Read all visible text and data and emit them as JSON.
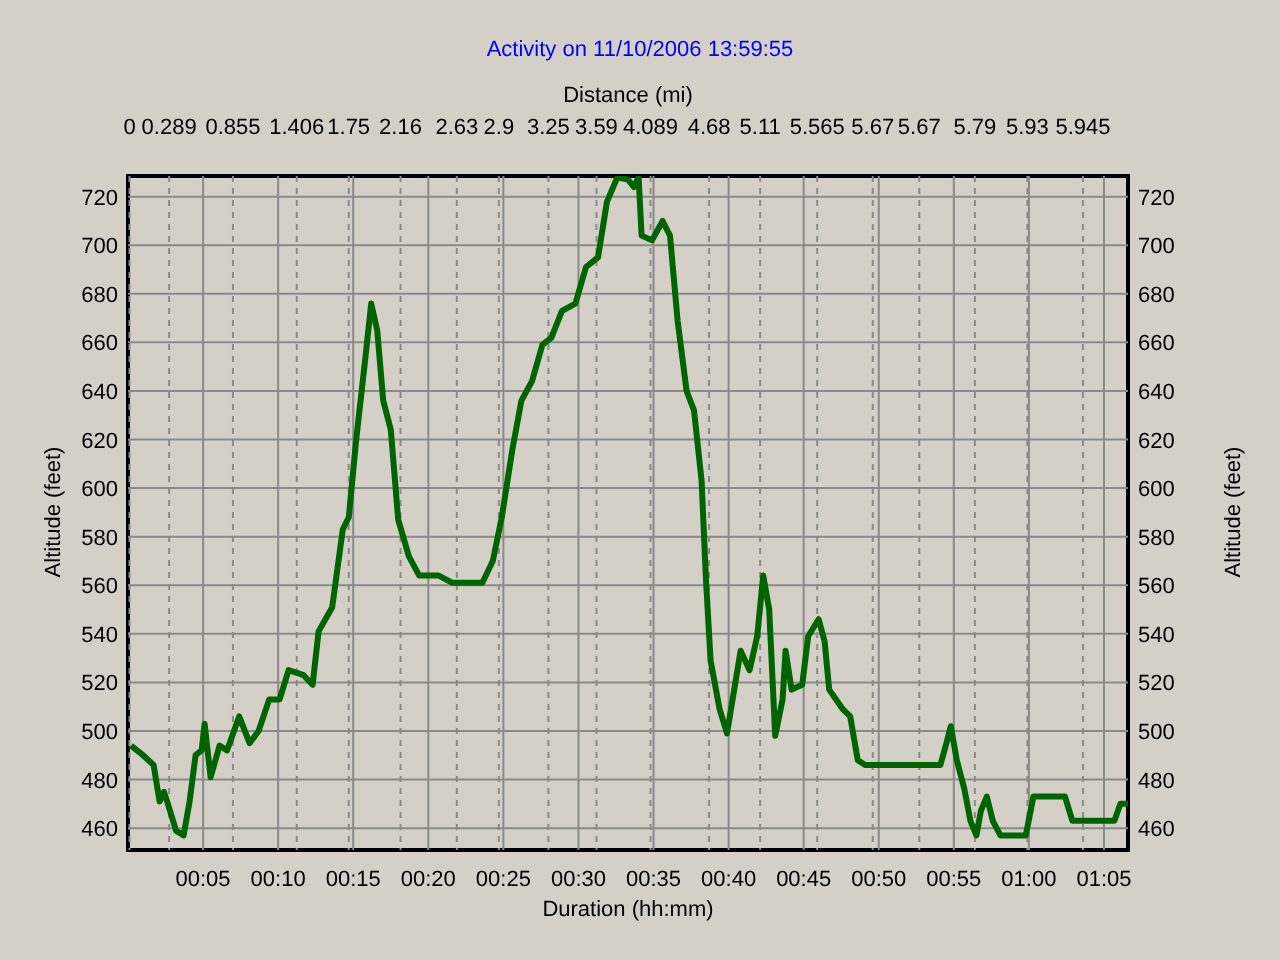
{
  "chart_data": {
    "type": "line",
    "title": "Activity on 11/10/2006 13:59:55",
    "xlabel": "Duration (hh:mm)",
    "ylabel": "Altitude (feet)",
    "y2label": "Altitude (feet)",
    "grid": true,
    "xlim": [
      0,
      66.6
    ],
    "ylim": [
      451,
      728.5
    ],
    "y2lim": [
      451,
      728.5
    ],
    "xticks": [
      {
        "value": 5,
        "label": "00:05"
      },
      {
        "value": 10,
        "label": "00:10"
      },
      {
        "value": 15,
        "label": "00:15"
      },
      {
        "value": 20,
        "label": "00:20"
      },
      {
        "value": 25,
        "label": "00:25"
      },
      {
        "value": 30,
        "label": "00:30"
      },
      {
        "value": 35,
        "label": "00:35"
      },
      {
        "value": 40,
        "label": "00:40"
      },
      {
        "value": 45,
        "label": "00:45"
      },
      {
        "value": 50,
        "label": "00:50"
      },
      {
        "value": 55,
        "label": "00:55"
      },
      {
        "value": 60,
        "label": "01:00"
      },
      {
        "value": 65,
        "label": "01:05"
      }
    ],
    "yticks": [
      460,
      480,
      500,
      520,
      540,
      560,
      580,
      600,
      620,
      640,
      660,
      680,
      700,
      720
    ],
    "y2ticks": [
      460,
      480,
      500,
      520,
      540,
      560,
      580,
      600,
      620,
      640,
      660,
      680,
      700,
      720
    ],
    "x": [
      0.2,
      1.0,
      1.7,
      2.1,
      2.4,
      2.7,
      3.2,
      3.7,
      4.1,
      4.5,
      4.9,
      5.1,
      5.5,
      6.1,
      6.6,
      7.4,
      8.1,
      8.7,
      9.4,
      10.1,
      10.7,
      11.7,
      12.3,
      12.7,
      13.6,
      14.3,
      14.7,
      15.2,
      15.8,
      16.2,
      16.6,
      17.0,
      17.5,
      18.0,
      18.7,
      19.4,
      20.7,
      21.6,
      23.6,
      24.3,
      24.9,
      25.6,
      26.2,
      26.9,
      27.6,
      28.2,
      28.9,
      29.8,
      30.5,
      31.3,
      31.9,
      32.6,
      33.3,
      33.7,
      34.0,
      34.2,
      34.9,
      35.6,
      36.1,
      36.6,
      37.2,
      37.7,
      38.2,
      38.5,
      38.8,
      39.4,
      39.9,
      40.4,
      40.8,
      41.4,
      41.9,
      42.3,
      42.7,
      43.1,
      43.6,
      43.8,
      44.2,
      44.9,
      45.3,
      46.0,
      46.4,
      46.7,
      47.6,
      48.1,
      48.6,
      49.1,
      54.1,
      54.5,
      54.8,
      55.2,
      55.7,
      56.1,
      56.5,
      56.8,
      57.2,
      57.6,
      58.1,
      59.8,
      60.3,
      62.4,
      62.9,
      65.7,
      66.1,
      66.6
    ],
    "series": [
      {
        "color": "#006400",
        "values": [
          494,
          490,
          486,
          471,
          475,
          469,
          459,
          457,
          471,
          490,
          492,
          503,
          481,
          494,
          492,
          506,
          495,
          500,
          513,
          513,
          525,
          523,
          519,
          541,
          551,
          583,
          588,
          620,
          653,
          676,
          665,
          636,
          624,
          587,
          572,
          564,
          564,
          561,
          561,
          570,
          588,
          616,
          636,
          644,
          659,
          662,
          673,
          676,
          691,
          695,
          718,
          728,
          727,
          724,
          728,
          704,
          702,
          710,
          704,
          669,
          640,
          632,
          603,
          562,
          529,
          509,
          499,
          518,
          533,
          525,
          539,
          564,
          550,
          498,
          513,
          533,
          517,
          519,
          539,
          546,
          537,
          517,
          509,
          506,
          488,
          486,
          486,
          495,
          502,
          488,
          476,
          463,
          457,
          467,
          473,
          463,
          457,
          457,
          473,
          473,
          463,
          463,
          470,
          470
        ]
      }
    ]
  },
  "distance_axis": {
    "title": "Distance (mi)",
    "labels": [
      "0",
      "0.289",
      "0.855",
      "1.406",
      "1.75",
      "2.16",
      "2.63",
      "2.9",
      "3.25",
      "3.59",
      "4.089",
      "4.68",
      "5.11",
      "5.565",
      "5.67",
      "5.67",
      "5.79",
      "5.93",
      "5.945"
    ]
  }
}
